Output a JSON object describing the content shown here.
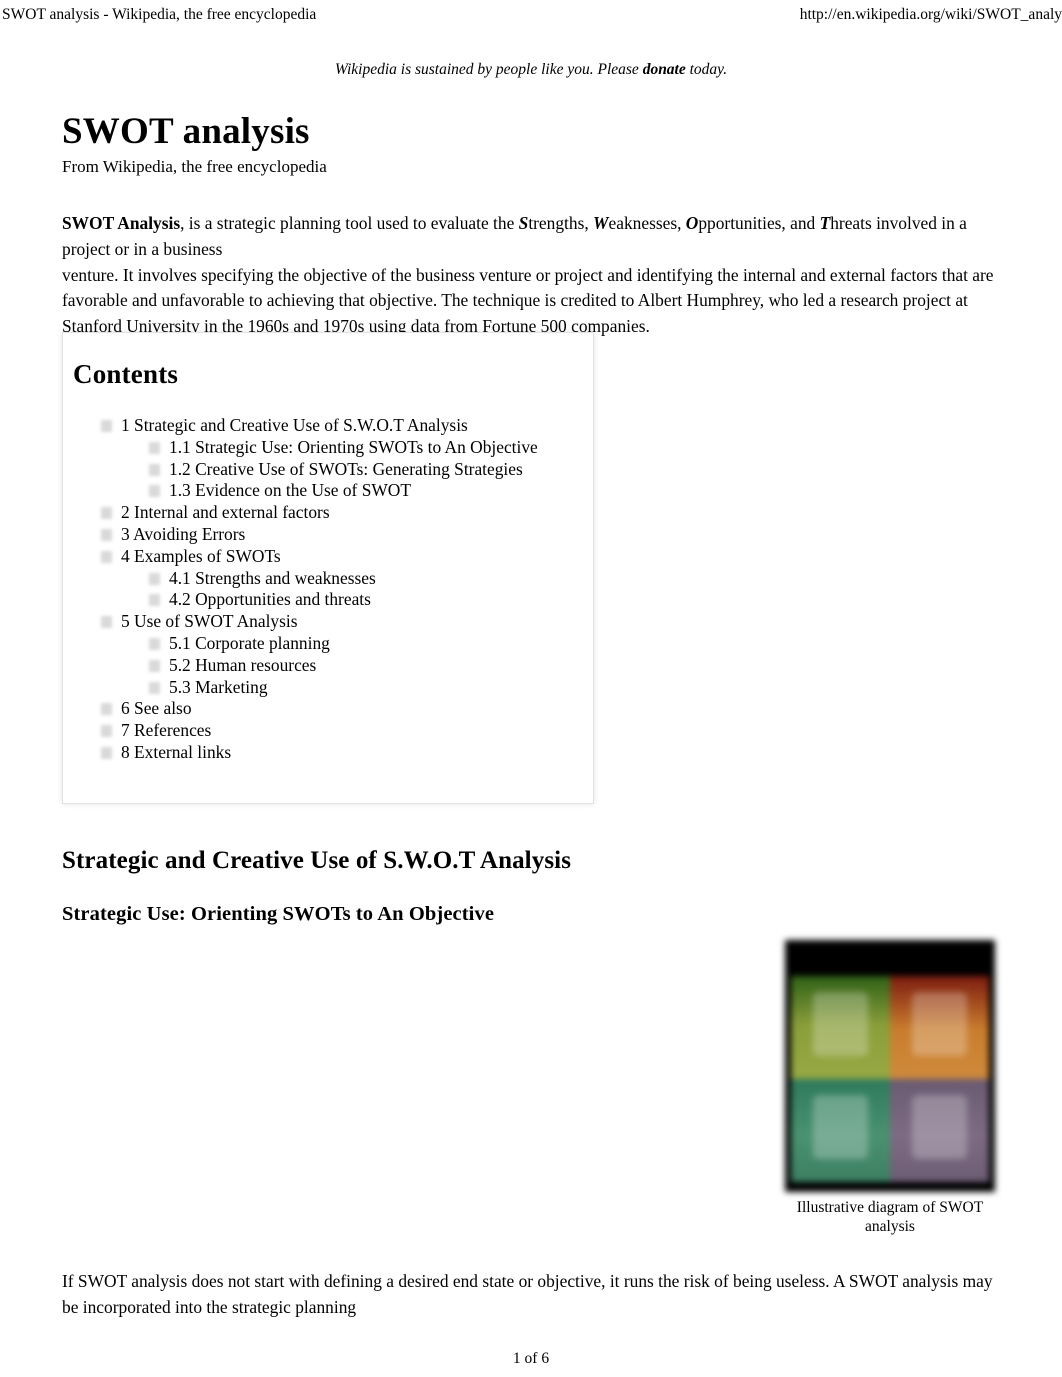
{
  "print_header": {
    "left": "SWOT analysis - Wikipedia, the free encyclopedia",
    "right": "http://en.wikipedia.org/wiki/SWOT_analy"
  },
  "banner": {
    "before": "Wikipedia is sustained by people like you. Please ",
    "link": "donate",
    "after": " today."
  },
  "article": {
    "title": "SWOT analysis",
    "from_line": "From Wikipedia, the free encyclopedia",
    "intro": {
      "lead_bold": "SWOT Analysis",
      "p1a": ", is a strategic planning tool used to evaluate the ",
      "s_letter": "S",
      "s_rest": "trengths, ",
      "w_letter": "W",
      "w_rest": "eaknesses, ",
      "o_letter": "O",
      "o_rest": "pportunities, and ",
      "t_letter": "T",
      "t_rest": "hreats involved in a project or in a business",
      "p2": "venture. It involves specifying the objective of the business venture or project and identifying the internal and external factors that are favorable and unfavorable to achieving that objective. The technique is credited to Albert Humphrey, who led a research project at Stanford University in the 1960s and 1970s using data from Fortune 500 companies."
    },
    "closing_para": "If SWOT analysis does not start with defining a desired end state or objective, it runs the risk of being useless. A SWOT analysis may be incorporated into the strategic planning"
  },
  "contents": {
    "title": "Contents",
    "items": [
      {
        "level": 1,
        "label": "1 Strategic and Creative Use of S.W.O.T Analysis"
      },
      {
        "level": 2,
        "label": "1.1 Strategic Use: Orienting SWOTs to An Objective"
      },
      {
        "level": 2,
        "label": "1.2 Creative Use of SWOTs: Generating Strategies"
      },
      {
        "level": 2,
        "label": "1.3 Evidence on the Use of SWOT"
      },
      {
        "level": 1,
        "label": "2 Internal and external factors"
      },
      {
        "level": 1,
        "label": "3 Avoiding Errors"
      },
      {
        "level": 1,
        "label": "4 Examples of SWOTs"
      },
      {
        "level": 2,
        "label": "4.1 Strengths and weaknesses"
      },
      {
        "level": 2,
        "label": "4.2 Opportunities and threats"
      },
      {
        "level": 1,
        "label": "5 Use of SWOT Analysis"
      },
      {
        "level": 2,
        "label": "5.1 Corporate planning"
      },
      {
        "level": 2,
        "label": "5.2 Human resources"
      },
      {
        "level": 2,
        "label": "5.3 Marketing"
      },
      {
        "level": 1,
        "label": "6 See also"
      },
      {
        "level": 1,
        "label": "7 References"
      },
      {
        "level": 1,
        "label": "8 External links"
      }
    ]
  },
  "headings": {
    "section_h2": "Strategic and Creative Use of S.W.O.T Analysis",
    "section_h3": "Strategic Use: Orienting SWOTs to An Objective"
  },
  "figure": {
    "caption": "Illustrative diagram of SWOT analysis",
    "quadrant_colors": {
      "strengths": "#8a9e3a",
      "weaknesses": "#c97d2e",
      "opportunities": "#4a9270",
      "threats": "#7d6b83",
      "background": "#000000"
    }
  },
  "footer": {
    "page_label": "1 of 6"
  }
}
